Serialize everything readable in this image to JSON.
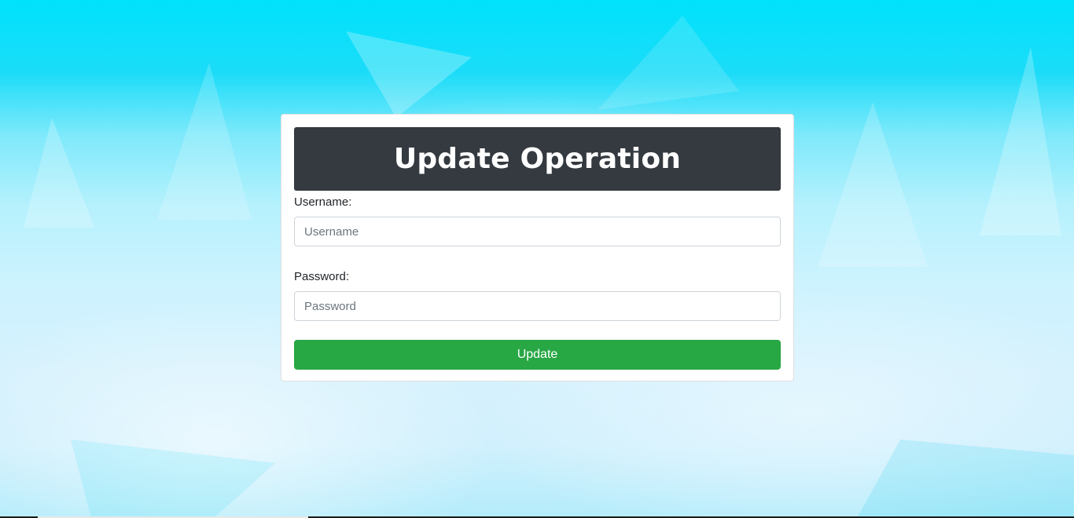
{
  "page": {
    "title": "Update Operation"
  },
  "form": {
    "username_label": "Username:",
    "username_placeholder": "Username",
    "username_value": "",
    "password_label": "Password:",
    "password_placeholder": "Password",
    "password_value": "",
    "submit_label": "Update"
  },
  "colors": {
    "header_bg": "#343a40",
    "button_bg": "#28a745",
    "background_top": "#00e2fc",
    "background_bottom": "#d0f0fd"
  }
}
